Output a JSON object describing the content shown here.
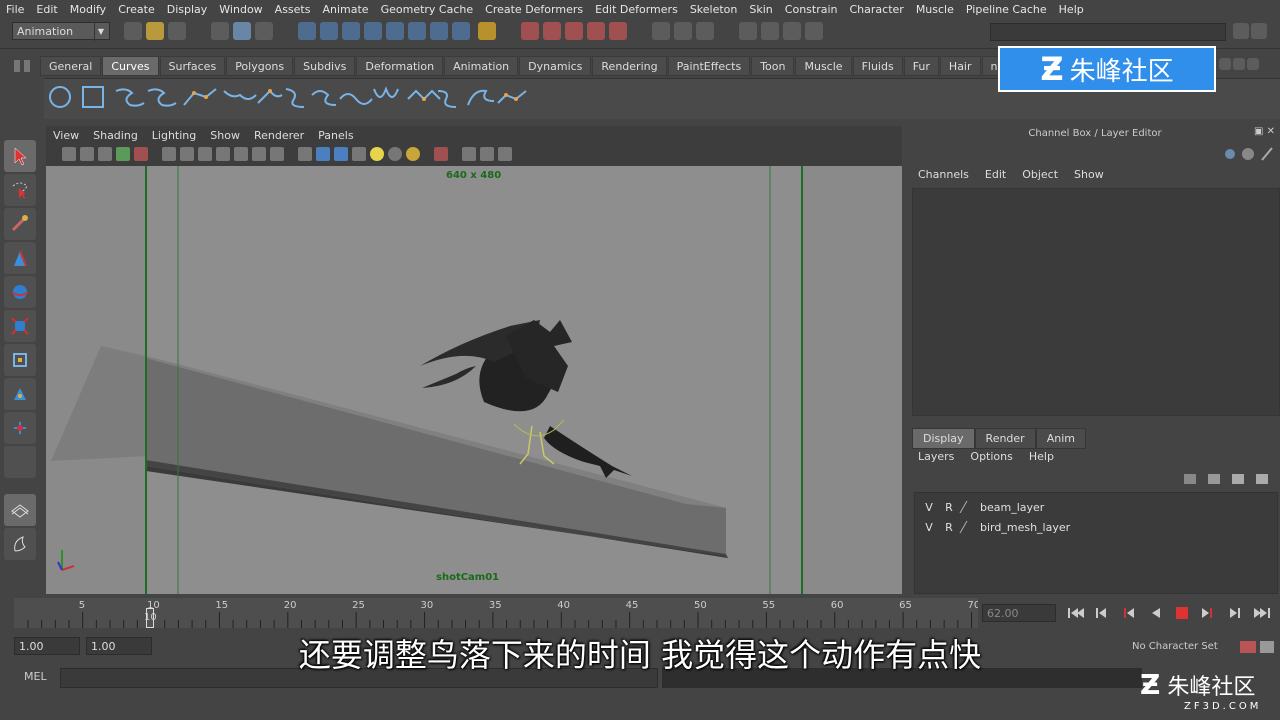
{
  "menubar": [
    "File",
    "Edit",
    "Modify",
    "Create",
    "Display",
    "Window",
    "Assets",
    "Animate",
    "Geometry Cache",
    "Create Deformers",
    "Edit Deformers",
    "Skeleton",
    "Skin",
    "Constrain",
    "Character",
    "Muscle",
    "Pipeline Cache",
    "Help"
  ],
  "status_line": {
    "mode": "Animation"
  },
  "shelf_tabs": [
    "General",
    "Curves",
    "Surfaces",
    "Polygons",
    "Subdivs",
    "Deformation",
    "Animation",
    "Dynamics",
    "Rendering",
    "PaintEffects",
    "Toon",
    "Muscle",
    "Fluids",
    "Fur",
    "Hair",
    "nClo"
  ],
  "shelf_active": "Curves",
  "logo": {
    "text": "朱峰社区"
  },
  "viewport": {
    "menu": [
      "View",
      "Shading",
      "Lighting",
      "Show",
      "Renderer",
      "Panels"
    ],
    "resolution": "640 x 480",
    "camera": "shotCam01"
  },
  "channel_box": {
    "title": "Channel Box / Layer Editor",
    "menu": [
      "Channels",
      "Edit",
      "Object",
      "Show"
    ],
    "layer_tabs": [
      "Display",
      "Render",
      "Anim"
    ],
    "layer_menu": [
      "Layers",
      "Options",
      "Help"
    ],
    "layers": [
      {
        "v": "V",
        "r": "R",
        "name": "beam_layer"
      },
      {
        "v": "V",
        "r": "R",
        "name": "bird_mesh_layer"
      }
    ]
  },
  "timeline": {
    "ticks": [
      "5",
      "10",
      "15",
      "20",
      "25",
      "30",
      "35",
      "40",
      "45",
      "50",
      "55",
      "60",
      "65",
      "70"
    ],
    "current_frame": "10",
    "end_field": "62.00"
  },
  "range_slider": {
    "start": "1.00",
    "current": "1.00",
    "character_set": "No Character Set"
  },
  "command_line": {
    "label": "MEL"
  },
  "subtitle": "还要调整鸟落下来的时间  我觉得这个动作有点快",
  "watermark": {
    "text": "朱峰社区",
    "url": "ZF3D.COM"
  },
  "colors": {
    "accent": "#2f8fea",
    "viewport_bg": "#8e8e8e",
    "safe_frame": "#1f6b2a"
  }
}
